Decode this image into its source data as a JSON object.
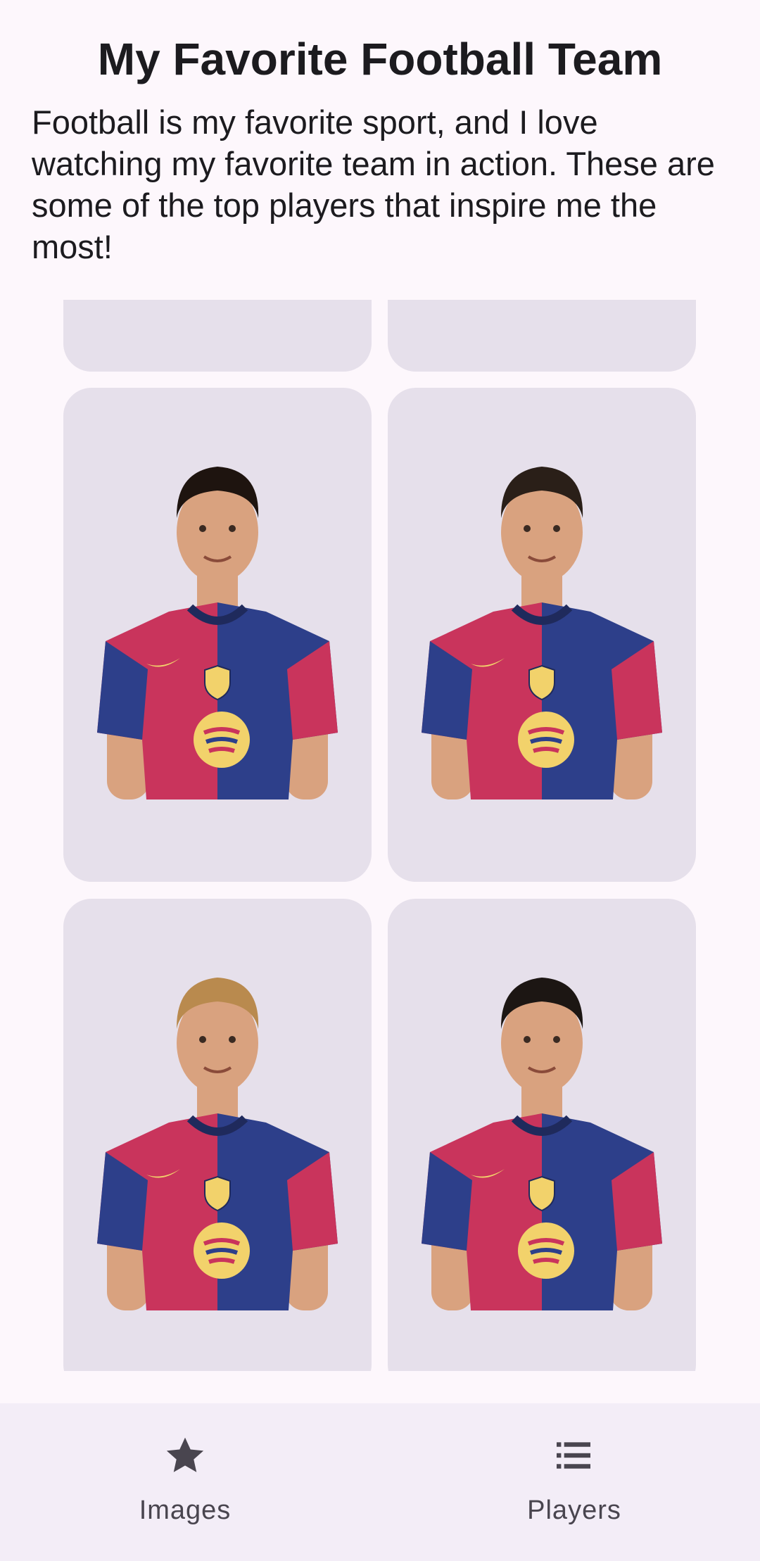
{
  "header": {
    "title": "My Favorite Football Team",
    "intro": "Football is my favorite sport, and I love watching my favorite team in action. These are some of the top players that inspire me the most!"
  },
  "players": [
    {
      "image": "player photo in team jersey",
      "hair": "#1e140f"
    },
    {
      "image": "player photo in team jersey",
      "hair": "#2a1f18"
    },
    {
      "image": "player photo in team jersey",
      "hair": "#b98a4e"
    },
    {
      "image": "player photo in team jersey",
      "hair": "#1c1613"
    }
  ],
  "colors": {
    "card_bg": "#e6e0eb",
    "jersey_red": "#c9345c",
    "jersey_blue": "#2d3f8a",
    "badge_yellow": "#f2d26b",
    "nav_bg": "#f3edf7"
  },
  "bottom_nav": {
    "items": [
      {
        "label": "Images",
        "icon": "star-icon"
      },
      {
        "label": "Players",
        "icon": "list-icon"
      }
    ]
  }
}
